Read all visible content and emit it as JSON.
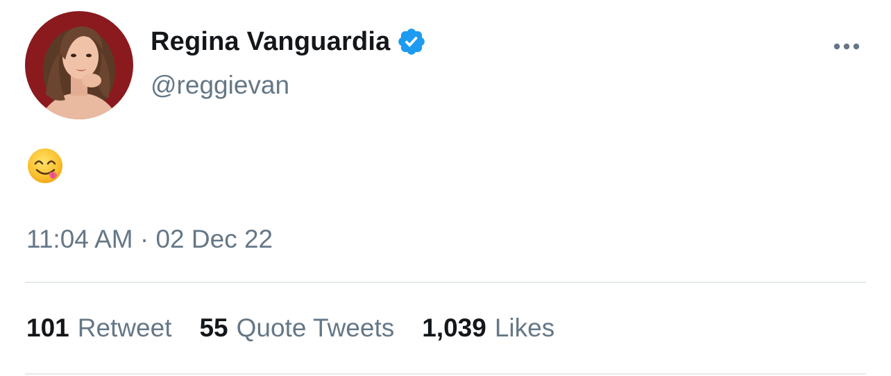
{
  "tweet": {
    "author": {
      "display_name": "Regina Vanguardia",
      "handle": "@reggievan",
      "verified": true
    },
    "body": {
      "emoji": "face-savoring-food-emoji"
    },
    "timestamp": "11:04 AM · 02 Dec 22",
    "stats": {
      "retweets": {
        "count": "101",
        "label": "Retweet"
      },
      "quote_tweets": {
        "count": "55",
        "label": "Quote Tweets"
      },
      "likes": {
        "count": "1,039",
        "label": "Likes"
      }
    }
  },
  "colors": {
    "text_primary": "#14171a",
    "text_secondary": "#657786",
    "verified_blue": "#1d9bf0",
    "divider": "#e6e9ec",
    "avatar_background": "#8a1a1e"
  },
  "icons": {
    "verified": "verified-badge-icon",
    "more": "more-horizontal-icon"
  }
}
